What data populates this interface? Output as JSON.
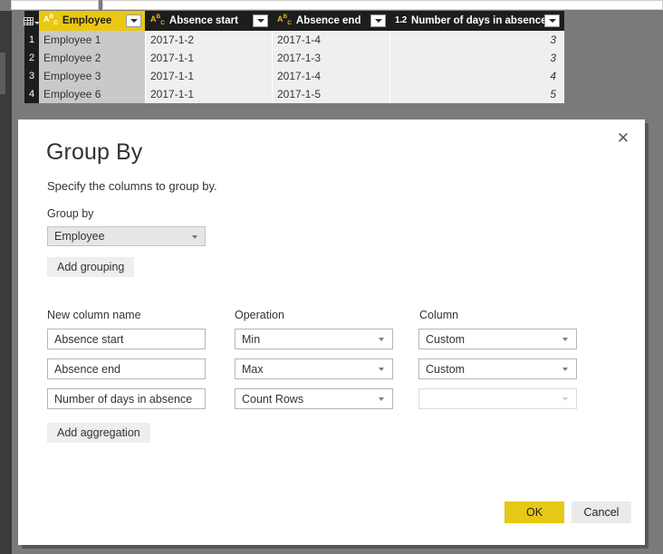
{
  "grid": {
    "corner_icon": "table-grid-icon",
    "columns": [
      {
        "name": "Employee",
        "type_icon": "abc-text-type-icon",
        "type_label": "ABC",
        "selected": true
      },
      {
        "name": "Absence start",
        "type_icon": "abc-text-type-icon",
        "type_label": "ABC",
        "selected": false
      },
      {
        "name": "Absence end",
        "type_icon": "abc-text-type-icon",
        "type_label": "ABC",
        "selected": false
      },
      {
        "name": "Number of days in absence",
        "type_icon": "decimal-number-type-icon",
        "type_label": "1.2",
        "selected": false
      }
    ],
    "rows": [
      {
        "num": "1",
        "employee": "Employee 1",
        "start": "2017-1-2",
        "end": "2017-1-4",
        "days": "3"
      },
      {
        "num": "2",
        "employee": "Employee 2",
        "start": "2017-1-1",
        "end": "2017-1-3",
        "days": "3"
      },
      {
        "num": "3",
        "employee": "Employee 3",
        "start": "2017-1-1",
        "end": "2017-1-4",
        "days": "4"
      },
      {
        "num": "4",
        "employee": "Employee 6",
        "start": "2017-1-1",
        "end": "2017-1-5",
        "days": "5"
      }
    ]
  },
  "dialog": {
    "title": "Group By",
    "subtitle": "Specify the columns to group by.",
    "close_icon": "close-icon",
    "group_by_label": "Group by",
    "group_by_value": "Employee",
    "add_grouping_label": "Add grouping",
    "headers": {
      "new_column_name": "New column name",
      "operation": "Operation",
      "column": "Column"
    },
    "aggregations": [
      {
        "new_column_name": "Absence start",
        "operation": "Min",
        "column": "Custom",
        "column_disabled": false
      },
      {
        "new_column_name": "Absence end",
        "operation": "Max",
        "column": "Custom",
        "column_disabled": false
      },
      {
        "new_column_name": "Number of days in absence",
        "operation": "Count Rows",
        "column": "",
        "column_disabled": true
      }
    ],
    "add_aggregation_label": "Add aggregation",
    "ok_label": "OK",
    "cancel_label": "Cancel",
    "accent_color": "#e6c817"
  }
}
